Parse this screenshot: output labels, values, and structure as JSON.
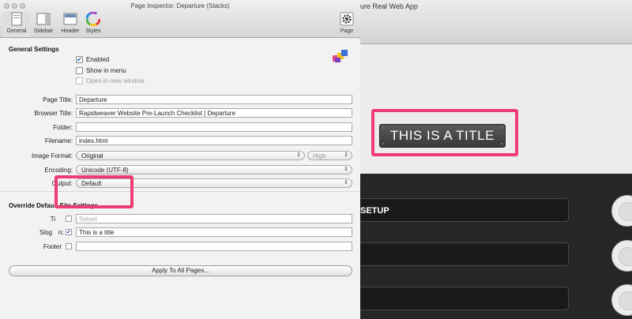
{
  "background_app": {
    "title": "ure Real Web App",
    "preview_title": "THIS IS A TITLE",
    "menu_bars": [
      "SETUP",
      "",
      ""
    ]
  },
  "inspector": {
    "window_title": "Page Inspector: Departure (Stacks)",
    "toolbar": {
      "tabs": [
        "General",
        "Sidebar",
        "Header",
        "Styles"
      ],
      "page_label": "Page"
    },
    "general_settings": {
      "heading": "General Settings",
      "enabled_label": "Enabled",
      "enabled_checked": true,
      "show_in_menu_label": "Show in menu",
      "show_in_menu_checked": false,
      "open_in_new_window_label": "Open in new window",
      "open_in_new_window_checked": false
    },
    "fields": {
      "page_title_label": "Page Title:",
      "page_title_value": "Departure",
      "browser_title_label": "Browser Title:",
      "browser_title_value": "Rapidweaver Website Pre-Launch Checklist  |  Departure",
      "folder_label": "Folder:",
      "folder_value": "",
      "filename_label": "Filename:",
      "filename_value": "index.html",
      "image_format_label": "Image Format:",
      "image_format_value": "Original",
      "image_quality_value": "High",
      "encoding_label": "Encoding:",
      "encoding_value": "Unicode (UTF-8)",
      "output_label": "Output:",
      "output_value": "Default"
    },
    "override": {
      "heading": "Override Default Site Settings",
      "title_label": "Ti",
      "title_value": "Setset",
      "title_checked": false,
      "slogan_label": "Slog",
      "slogan_label_tail": "n:",
      "slogan_value": "This is a title",
      "slogan_checked": true,
      "footer_label": "Footer",
      "footer_value": "",
      "footer_checked": false
    },
    "apply_button_label": "Apply To All Pages..."
  },
  "colors": {
    "highlight": "#ef3d74",
    "check_accent": "#1e4fb0"
  }
}
